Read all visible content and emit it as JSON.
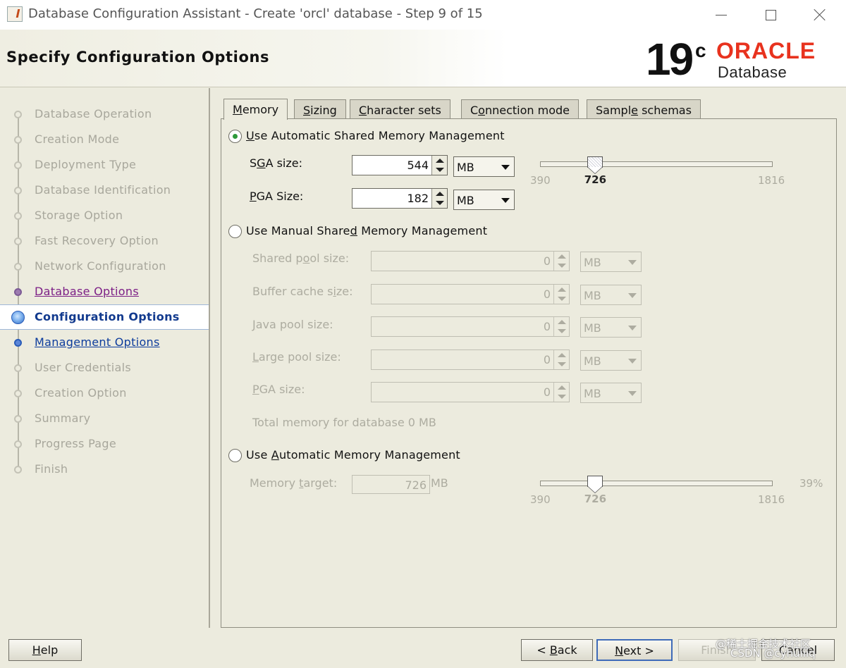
{
  "window": {
    "title": "Database Configuration Assistant - Create 'orcl' database - Step 9 of 15"
  },
  "header": {
    "page_title": "Specify Configuration Options",
    "logo_version": "19",
    "logo_version_sup": "c",
    "logo_brand": "ORACLE",
    "logo_product": "Database"
  },
  "nav": {
    "items": [
      {
        "label": "Database Operation",
        "state": "done"
      },
      {
        "label": "Creation Mode",
        "state": "done"
      },
      {
        "label": "Deployment Type",
        "state": "done"
      },
      {
        "label": "Database Identification",
        "state": "done"
      },
      {
        "label": "Storage Option",
        "state": "done"
      },
      {
        "label": "Fast Recovery Option",
        "state": "done"
      },
      {
        "label": "Network Configuration",
        "state": "done"
      },
      {
        "label": "Database Options",
        "state": "visited"
      },
      {
        "label": "Configuration Options",
        "state": "current"
      },
      {
        "label": "Management Options",
        "state": "next"
      },
      {
        "label": "User Credentials",
        "state": "pending"
      },
      {
        "label": "Creation Option",
        "state": "pending"
      },
      {
        "label": "Summary",
        "state": "pending"
      },
      {
        "label": "Progress Page",
        "state": "pending"
      },
      {
        "label": "Finish",
        "state": "pending"
      }
    ]
  },
  "tabs": {
    "memory": {
      "pre": "",
      "key": "M",
      "post": "emory"
    },
    "sizing": {
      "pre": "",
      "key": "S",
      "post": "izing"
    },
    "charsets": {
      "pre": "",
      "key": "C",
      "post": "haracter sets"
    },
    "connection": {
      "pre": "C",
      "key": "o",
      "post": "nnection mode"
    },
    "sample": {
      "pre": "Sampl",
      "key": "e",
      "post": " schemas"
    }
  },
  "asmm": {
    "radio_pre": "",
    "radio_key": "U",
    "radio_post": "se Automatic Shared Memory Management",
    "sga_label_pre": "S",
    "sga_label_key": "G",
    "sga_label_post": "A size:",
    "sga_value": "544",
    "sga_unit": "MB",
    "pga_label_pre": "",
    "pga_label_key": "P",
    "pga_label_post": "GA Size:",
    "pga_value": "182",
    "pga_unit": "MB",
    "slider_min": "390",
    "slider_max": "1816",
    "slider_value": "726",
    "slider_value_num": 726,
    "slider_min_num": 390,
    "slider_max_num": 1816
  },
  "manual": {
    "radio_pre": "Use Manual Share",
    "radio_key": "d",
    "radio_post": " Memory Management",
    "rows": [
      {
        "pre": "Shared p",
        "key": "o",
        "post": "ol size:",
        "value": "0",
        "unit": "MB"
      },
      {
        "pre": "Buffer cache s",
        "key": "i",
        "post": "ze:",
        "value": "0",
        "unit": "MB"
      },
      {
        "pre": "",
        "key": "J",
        "post": "ava pool size:",
        "value": "0",
        "unit": "MB"
      },
      {
        "pre": "",
        "key": "L",
        "post": "arge pool size:",
        "value": "0",
        "unit": "MB"
      },
      {
        "pre": "",
        "key": "P",
        "post": "GA size:",
        "value": "0",
        "unit": "MB"
      }
    ],
    "total_text": "Total memory for database 0 MB"
  },
  "amm": {
    "radio_pre": "Use ",
    "radio_key": "A",
    "radio_post": "utomatic Memory Management",
    "target_label_pre": "Memory ",
    "target_label_key": "t",
    "target_label_post": "arget:",
    "target_value": "726",
    "target_unit": "MB",
    "slider_min": "390",
    "slider_max": "1816",
    "slider_value": "726",
    "percent": "39%",
    "slider_value_num": 726,
    "slider_min_num": 390,
    "slider_max_num": 1816
  },
  "buttons": {
    "help_key": "H",
    "help_post": "elp",
    "back_pre": "< ",
    "back_key": "B",
    "back_post": "ack",
    "next_key": "N",
    "next_post": "ext >",
    "finish": "Finish",
    "cancel": "Cancel"
  },
  "watermark": {
    "line1": "@稀土掘金技术社区",
    "line2": "CSDN @cyhuiiiq"
  }
}
